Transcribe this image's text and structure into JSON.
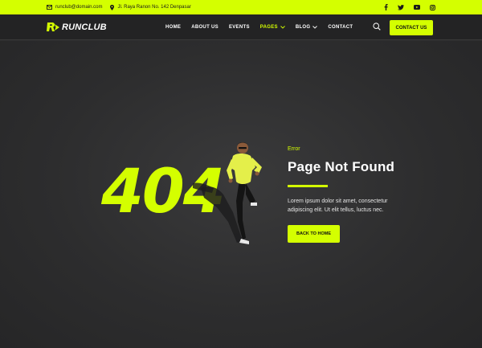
{
  "topbar": {
    "email": "runclub@domain.com",
    "address": "Jl. Raya Ranon No. 142 Denpasar",
    "socials": [
      "facebook-icon",
      "twitter-icon",
      "youtube-icon",
      "instagram-icon"
    ]
  },
  "header": {
    "logo": "RUNCLUB",
    "nav": [
      {
        "label": "HOME"
      },
      {
        "label": "ABOUT US"
      },
      {
        "label": "EVENTS"
      },
      {
        "label": "PAGES"
      },
      {
        "label": "BLOG"
      },
      {
        "label": "CONTACT"
      }
    ],
    "contact_button": "CONTACT US"
  },
  "hero": {
    "code": "404",
    "label": "Error",
    "title": "Page Not Found",
    "description": "Lorem ipsum dolor sit amet, consectetur adipiscing elit. Ut elit tellus, luctus nec.",
    "button": "BACK TO HOME"
  },
  "colors": {
    "accent": "#d4ff00",
    "background": "#2c2c2d",
    "header": "#232324"
  }
}
